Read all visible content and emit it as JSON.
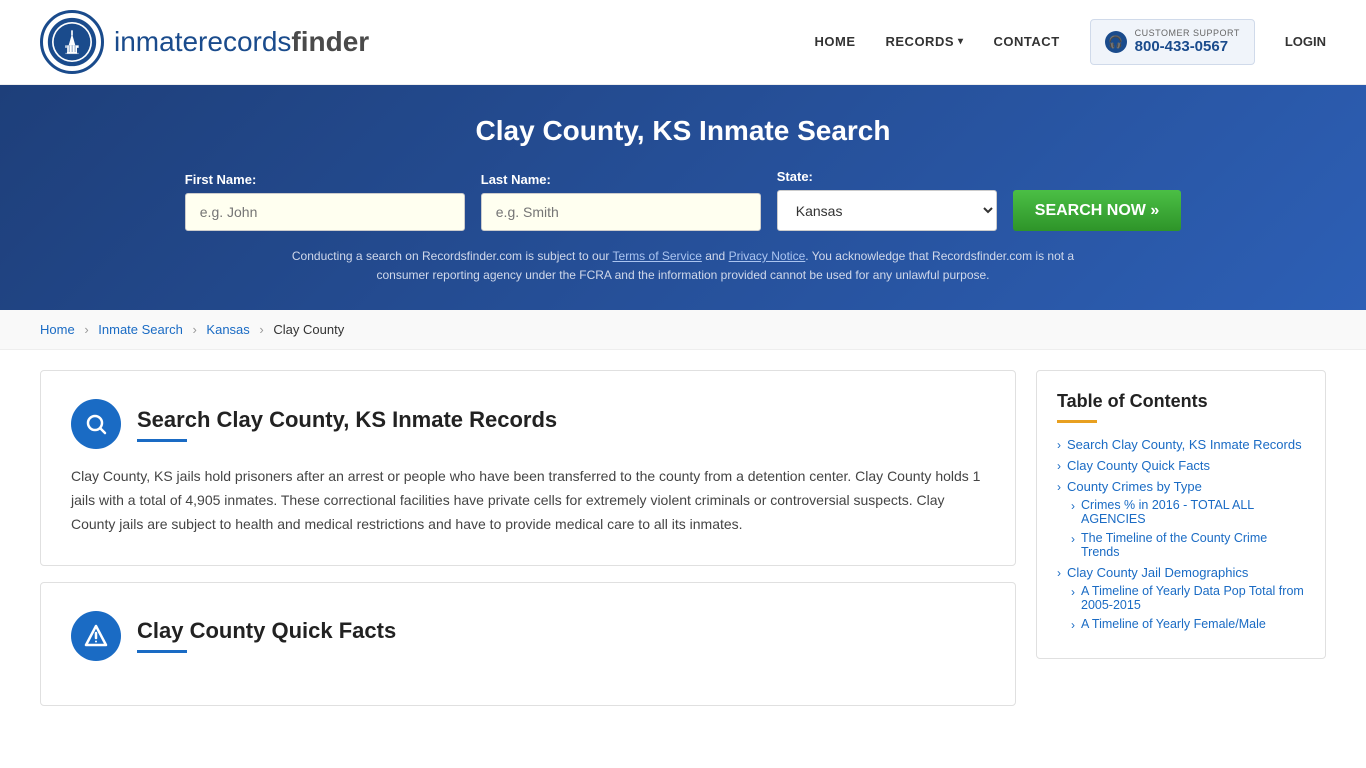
{
  "site": {
    "logo_text_main": "inmaterecords",
    "logo_text_bold": "finder",
    "title": "Clay County, KS Inmate Search"
  },
  "nav": {
    "home_label": "HOME",
    "records_label": "RECORDS",
    "contact_label": "CONTACT",
    "customer_support_label": "CUSTOMER SUPPORT",
    "customer_support_phone": "800-433-0567",
    "login_label": "LOGIN"
  },
  "search_form": {
    "title": "Clay County, KS Inmate Search",
    "first_name_label": "First Name:",
    "first_name_placeholder": "e.g. John",
    "last_name_label": "Last Name:",
    "last_name_placeholder": "e.g. Smith",
    "state_label": "State:",
    "state_value": "Kansas",
    "search_button_label": "SEARCH NOW »",
    "disclaimer": "Conducting a search on Recordsfinder.com is subject to our Terms of Service and Privacy Notice. You acknowledge that Recordsfinder.com is not a consumer reporting agency under the FCRA and the information provided cannot be used for any unlawful purpose."
  },
  "breadcrumb": {
    "home": "Home",
    "inmate_search": "Inmate Search",
    "kansas": "Kansas",
    "clay_county": "Clay County"
  },
  "main_section": {
    "title": "Search Clay County, KS Inmate Records",
    "text": "Clay County, KS jails hold prisoners after an arrest or people who have been transferred to the county from a detention center. Clay County holds 1 jails with a total of 4,905 inmates. These correctional facilities have private cells for extremely violent criminals or controversial suspects. Clay County jails are subject to health and medical restrictions and have to provide medical care to all its inmates."
  },
  "quick_facts_section": {
    "title": "Clay County Quick Facts"
  },
  "toc": {
    "title": "Table of Contents",
    "items": [
      {
        "label": "Search Clay County, KS Inmate Records",
        "sub": false
      },
      {
        "label": "Clay County Quick Facts",
        "sub": false
      },
      {
        "label": "County Crimes by Type",
        "sub": false
      },
      {
        "label": "Crimes % in 2016 - TOTAL ALL AGENCIES",
        "sub": true
      },
      {
        "label": "The Timeline of the County Crime Trends",
        "sub": true
      },
      {
        "label": "Clay County Jail Demographics",
        "sub": false
      },
      {
        "label": "A Timeline of Yearly Data Pop Total from 2005-2015",
        "sub": true
      },
      {
        "label": "A Timeline of Yearly Female/Male",
        "sub": true
      }
    ]
  }
}
